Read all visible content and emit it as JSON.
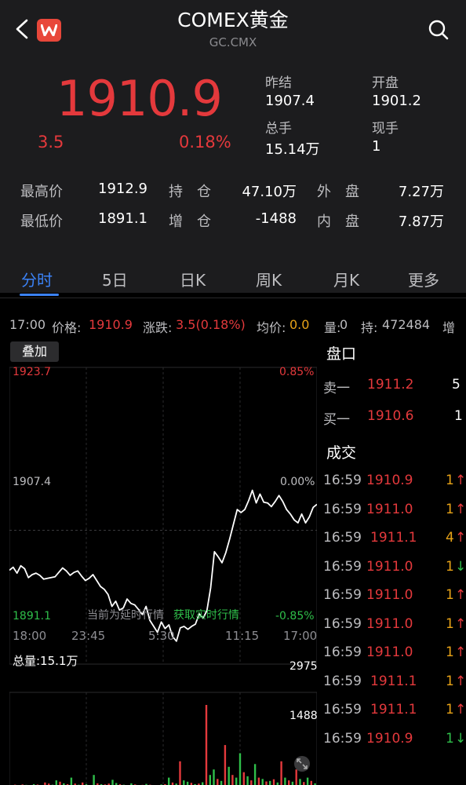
{
  "header": {
    "title": "COMEX黄金",
    "subtitle": "GC.CMX",
    "logo_letter": "W"
  },
  "quote": {
    "price": "1910.9",
    "change": "3.5",
    "change_pct": "0.18%",
    "prev_settle_label": "昨结",
    "prev_settle": "1907.4",
    "open_label": "开盘",
    "open": "1901.2",
    "total_volume_label": "总手",
    "total_volume": "15.14万",
    "current_volume_label": "现手",
    "current_volume": "1"
  },
  "stats": {
    "high_label": "最高价",
    "high": "1912.9",
    "low_label": "最低价",
    "low": "1891.1",
    "open_interest_label": "持　仓",
    "open_interest": "47.10万",
    "oi_change_label": "增　仓",
    "oi_change": "-1488",
    "outer_label": "外　盘",
    "outer": "7.27万",
    "inner_label": "内　盘",
    "inner": "7.87万"
  },
  "tabs": [
    "分时",
    "5日",
    "日K",
    "周K",
    "月K",
    "更多"
  ],
  "info_bar": {
    "time": "17:00",
    "price_label": "价格:",
    "price": "1910.9",
    "change_label": "涨跌:",
    "change": "3.5(0.18%)",
    "avg_label": "均价:",
    "avg": "0.0",
    "volume_label": "量:",
    "volume": "0",
    "oi_label": "持:",
    "oi": "472484",
    "more_label": "增"
  },
  "intraday": {
    "overlay_label": "叠加",
    "y_top": "1923.7",
    "y_mid": "1907.4",
    "y_bottom": "1891.1",
    "pct_top": "0.85%",
    "pct_mid": "0.00%",
    "pct_bottom": "-0.85%",
    "time_labels": [
      "18:00",
      "23:45",
      "5:30",
      "11:15",
      "17:00"
    ],
    "delay_note": "当前为延时行情",
    "realtime_link": "获取实时行情",
    "volume_total": "总量:15.1万",
    "vol_max": "2975",
    "vol_mid": "1488"
  },
  "chart_data": {
    "type": "line",
    "title": "",
    "ylim": [
      1891.1,
      1923.7
    ],
    "reference": 1907.4,
    "x": [
      "18:00",
      "23:45",
      "5:30",
      "11:15",
      "17:00"
    ],
    "series": [
      {
        "values": [
          1902.0,
          1902.4,
          1901.6,
          1902.6,
          1902.2,
          1901.0,
          1901.4,
          1901.6,
          1901.3,
          1900.8,
          1900.9,
          1901.0,
          1901.1,
          1901.7,
          1902.3,
          1901.9,
          1901.3,
          1901.7,
          1901.9,
          1901.2,
          1900.6,
          1900.9,
          1901.4,
          1900.6,
          1899.8,
          1899.4,
          1898.7,
          1897.1,
          1897.8,
          1896.6,
          1896.9,
          1898.1,
          1897.5,
          1897.3,
          1896.7,
          1896.0,
          1897.1,
          1895.2,
          1894.4,
          1893.6,
          1895.0,
          1894.1,
          1894.6,
          1893.0,
          1892.4,
          1894.2,
          1894.4,
          1894.0,
          1894.4,
          1894.7,
          1896.1,
          1895.5,
          1896.5,
          1899.6,
          1904.5,
          1903.8,
          1903.0,
          1904.4,
          1906.2,
          1908.2,
          1910.2,
          1909.8,
          1910.2,
          1911.4,
          1912.8,
          1911.1,
          1912.3,
          1911.2,
          1911.1,
          1910.6,
          1911.3,
          1912.1,
          1911.3,
          1910.2,
          1909.6,
          1908.8,
          1908.4,
          1909.6,
          1908.4,
          1909.2,
          1910.5,
          1910.9
        ]
      }
    ],
    "volume": {
      "ylim": [
        0,
        2975
      ],
      "bars": [
        30,
        40,
        25,
        50,
        35,
        20,
        60,
        45,
        30,
        120,
        80,
        40,
        200,
        150,
        90,
        60,
        300,
        80,
        40,
        120,
        60,
        30,
        400,
        90,
        60,
        50,
        80,
        220,
        100,
        60,
        40,
        30,
        90,
        50,
        25,
        35,
        70,
        40,
        30,
        20,
        50,
        60,
        300,
        120,
        80,
        900,
        200,
        150,
        110,
        60,
        80,
        130,
        2975,
        400,
        600,
        250,
        180,
        1500,
        700,
        400,
        300,
        1200,
        500,
        350,
        200,
        800,
        300,
        250,
        160,
        180,
        240,
        120,
        900,
        300,
        200,
        150,
        600,
        250,
        140,
        300,
        180,
        90
      ],
      "colors": [
        "g",
        "r",
        "g",
        "r",
        "g",
        "r",
        "g",
        "r",
        "g",
        "r",
        "r",
        "g",
        "g",
        "r",
        "g",
        "r",
        "g",
        "r",
        "g",
        "r",
        "g",
        "r",
        "g",
        "r",
        "g",
        "r",
        "r",
        "g",
        "g",
        "r",
        "g",
        "r",
        "g",
        "r",
        "g",
        "r",
        "g",
        "r",
        "g",
        "r",
        "g",
        "r",
        "g",
        "r",
        "g",
        "r",
        "g",
        "g",
        "r",
        "g",
        "r",
        "g",
        "r",
        "g",
        "g",
        "r",
        "g",
        "r",
        "g",
        "r",
        "g",
        "g",
        "r",
        "g",
        "r",
        "g",
        "r",
        "g",
        "r",
        "g",
        "r",
        "g",
        "r",
        "g",
        "r",
        "g",
        "r",
        "g",
        "r",
        "g",
        "r",
        "g"
      ]
    }
  },
  "order_book": {
    "title": "盘口",
    "rows": [
      {
        "label": "卖一",
        "price": "1911.2",
        "qty": "5"
      },
      {
        "label": "买一",
        "price": "1910.6",
        "qty": "1"
      }
    ]
  },
  "trades": {
    "title": "成交",
    "rows": [
      {
        "time": "16:59",
        "price": "1910.9",
        "qty": "1",
        "arrow": "↑",
        "qty_color": "orange",
        "arrow_color": "red"
      },
      {
        "time": "16:59",
        "price": "1911.0",
        "qty": "1",
        "arrow": "↑",
        "qty_color": "orange",
        "arrow_color": "red"
      },
      {
        "time": "16:59",
        "price": "1911.1",
        "qty": "4",
        "arrow": "↑",
        "qty_color": "orange",
        "arrow_color": "red"
      },
      {
        "time": "16:59",
        "price": "1911.0",
        "qty": "1",
        "arrow": "↓",
        "qty_color": "orange",
        "arrow_color": "green"
      },
      {
        "time": "16:59",
        "price": "1911.0",
        "qty": "1",
        "arrow": "↑",
        "qty_color": "orange",
        "arrow_color": "red"
      },
      {
        "time": "16:59",
        "price": "1911.0",
        "qty": "1",
        "arrow": "↑",
        "qty_color": "orange",
        "arrow_color": "red"
      },
      {
        "time": "16:59",
        "price": "1911.0",
        "qty": "1",
        "arrow": "↑",
        "qty_color": "orange",
        "arrow_color": "red"
      },
      {
        "time": "16:59",
        "price": "1911.1",
        "qty": "1",
        "arrow": "↑",
        "qty_color": "orange",
        "arrow_color": "red"
      },
      {
        "time": "16:59",
        "price": "1911.1",
        "qty": "1",
        "arrow": "↑",
        "qty_color": "orange",
        "arrow_color": "red"
      },
      {
        "time": "16:59",
        "price": "1910.9",
        "qty": "1",
        "arrow": "↓",
        "qty_color": "green",
        "arrow_color": "green"
      }
    ]
  },
  "colors": {
    "up": "#e4393c",
    "down": "#2fbf4a",
    "accent": "#3b82f6",
    "qty_orange": "#e8a317",
    "header_bg": "#1c1c1e"
  },
  "icons": {
    "back": "chevron-left-icon",
    "search": "search-icon",
    "expand": "expand-icon"
  }
}
